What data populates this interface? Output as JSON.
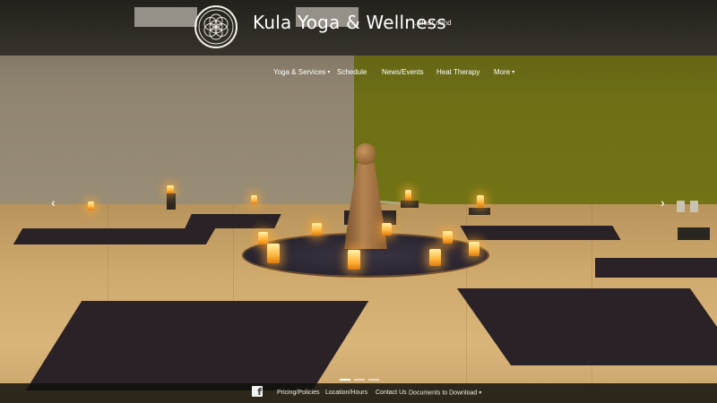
{
  "header": {
    "logo_icon": "flower-of-life-icon",
    "brand": "Kula Yoga & Wellness",
    "tagline": "...clear mind"
  },
  "nav": {
    "items": [
      {
        "label": "Yoga & Services",
        "has_caret": true
      },
      {
        "label": "Schedule",
        "has_caret": false
      },
      {
        "label": "News/Events",
        "has_caret": false
      },
      {
        "label": "Heat Therapy",
        "has_caret": false
      },
      {
        "label": "More",
        "has_caret": true
      }
    ],
    "caret_glyph": "▾"
  },
  "carousel": {
    "prev_glyph": "‹",
    "next_glyph": "›",
    "slide_count": 3,
    "active_slide": 1
  },
  "footer": {
    "facebook_icon": "facebook-icon",
    "facebook_glyph": "f",
    "links": [
      {
        "label": "Pricing/Policies"
      },
      {
        "label": "Location/Hours"
      },
      {
        "label": "Contact Us"
      },
      {
        "label": "Documents to Download",
        "has_caret": true
      }
    ]
  },
  "colors": {
    "wall_left": "#9a8e77",
    "wall_right": "#727414",
    "floor": "#cfa96d",
    "mat": "#2a2226",
    "candle_glow": "#ffb43a",
    "nav_text": "#ffffff"
  }
}
